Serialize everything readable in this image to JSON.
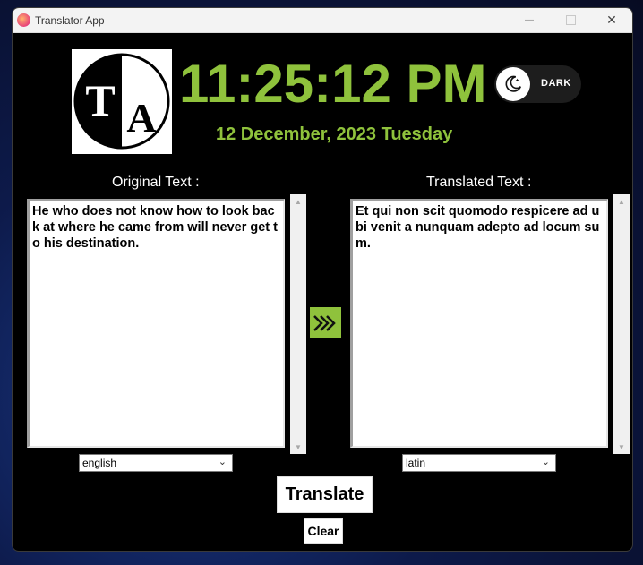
{
  "window": {
    "title": "Translator App",
    "icon": "translator-app-icon"
  },
  "window_controls": {
    "minimize": "—",
    "maximize": "",
    "close": "✕"
  },
  "logo": {
    "letter1": "T",
    "letter2": "A"
  },
  "clock": {
    "time": "11:25:12 PM",
    "date": "12 December, 2023 Tuesday"
  },
  "theme_toggle": {
    "label": "DARK",
    "icon": "moon-icon"
  },
  "original": {
    "label": "Original Text :",
    "text": "He who does not know how to look back at where he came from will never get to his destination.",
    "language": "english"
  },
  "translated": {
    "label": "Translated Text :",
    "text": "Et qui non scit quomodo respicere ad ubi venit a nunquam adepto ad locum sum.",
    "language": "latin"
  },
  "buttons": {
    "translate": "Translate",
    "clear": "Clear",
    "swap_icon": "double-chevron-right-icon"
  },
  "colors": {
    "accent": "#8fc23c",
    "background": "#000000"
  }
}
